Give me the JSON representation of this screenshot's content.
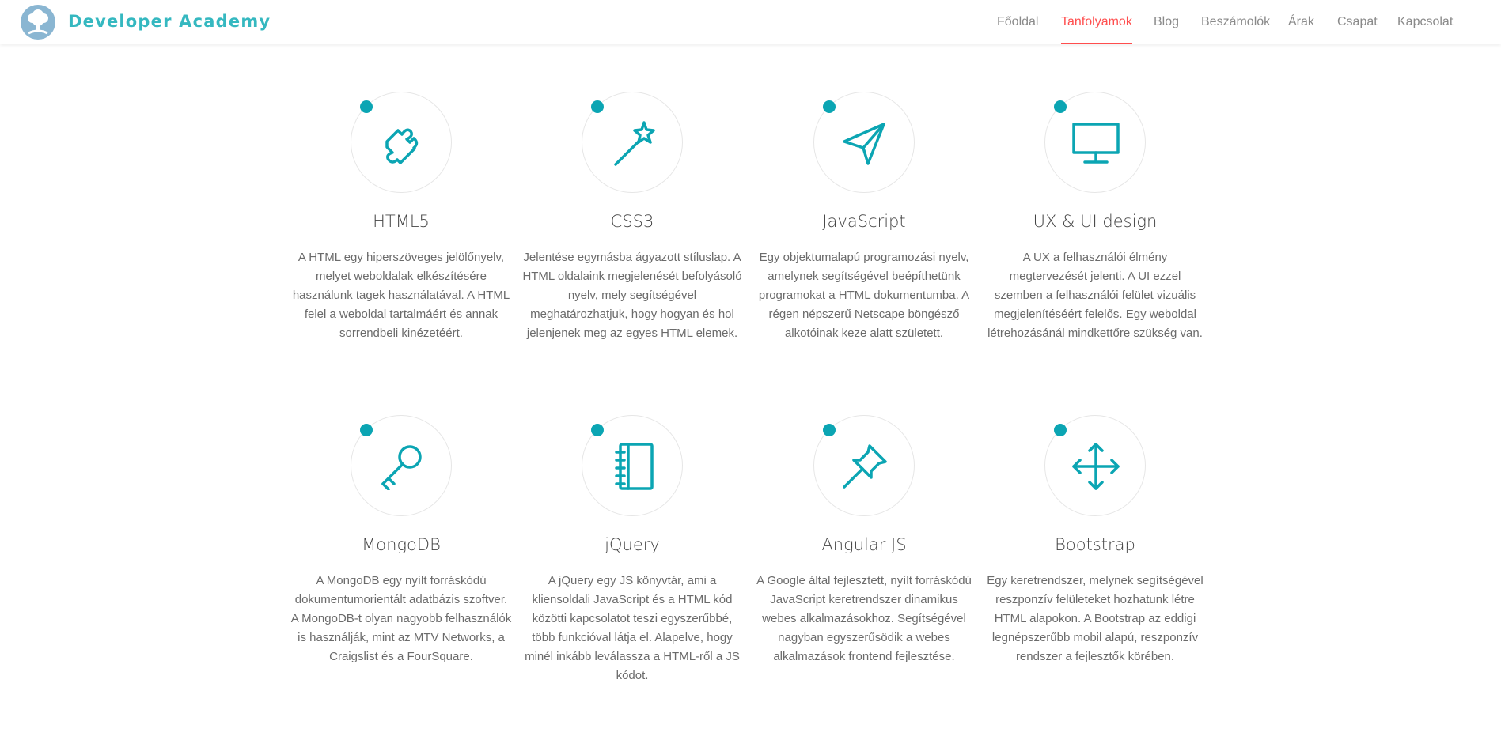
{
  "header": {
    "brand": "Developer Academy",
    "nav": [
      {
        "label": "Főoldal",
        "active": false
      },
      {
        "label": "Tanfolyamok",
        "active": true
      },
      {
        "label": "Blog",
        "active": false
      },
      {
        "label": "Beszámolók",
        "active": false
      },
      {
        "label": "Árak",
        "active": false
      },
      {
        "label": "Csapat",
        "active": false
      },
      {
        "label": "Kapcsolat",
        "active": false
      }
    ]
  },
  "colors": {
    "accent": "#0ba5b3",
    "active_nav": "#ff4e4e",
    "brand": "#35b8c0"
  },
  "courses": [
    {
      "title": "HTML5",
      "icon": "puzzle-icon",
      "text": "A HTML egy hiperszöveges jelölőnyelv, melyet weboldalak elkészítésére használunk tagek használatával. A HTML felel a weboldal tartalmáért és annak sorrendbeli kinézetéért."
    },
    {
      "title": "CSS3",
      "icon": "magic-wand-icon",
      "text": "Jelentése egymásba ágyazott stíluslap. A HTML oldalaink megjelenését befolyásoló nyelv, mely segítségével meghatározhatjuk, hogy hogyan és hol jelenjenek meg az egyes HTML elemek."
    },
    {
      "title": "JavaScript",
      "icon": "paper-plane-icon",
      "text": "Egy objektumalapú programozási nyelv, amelynek segítségével beépíthetünk programokat a HTML dokumentumba. A régen népszerű Netscape böngésző alkotóinak keze alatt született."
    },
    {
      "title": "UX & UI design",
      "icon": "monitor-icon",
      "text": "A UX a felhasználói élmény megtervezését jelenti. A UI ezzel szemben a felhasználói felület vizuális megjelenítéséért felelős. Egy weboldal létrehozásánál mindkettőre szükség van."
    },
    {
      "title": "MongoDB",
      "icon": "key-icon",
      "text": "A MongoDB egy nyílt forráskódú dokumentumorientált adatbázis szoftver. A MongoDB-t olyan nagyobb felhasználók is használják, mint az MTV Networks, a Craigslist és a FourSquare."
    },
    {
      "title": "jQuery",
      "icon": "notebook-icon",
      "text": "A jQuery egy JS könyvtár, ami a kliensoldali JavaScript és a HTML kód közötti kapcsolatot teszi egyszerűbbé, több funkcióval látja el. Alapelve, hogy minél inkább leválassza a HTML-ről a JS kódot."
    },
    {
      "title": "Angular JS",
      "icon": "pushpin-icon",
      "text": "A Google által fejlesztett, nyílt forráskódú JavaScript keretrendszer dinamikus webes alkalmazásokhoz. Segítségével nagyban egyszerűsödik a webes alkalmazások frontend fejlesztése."
    },
    {
      "title": "Bootstrap",
      "icon": "move-arrows-icon",
      "text": "Egy keretrendszer, melynek segítségével reszponzív felületeket hozhatunk létre HTML alapokon. A Bootstrap az eddigi legnépszerűbb mobil alapú, reszponzív rendszer a fejlesztők körében."
    }
  ]
}
